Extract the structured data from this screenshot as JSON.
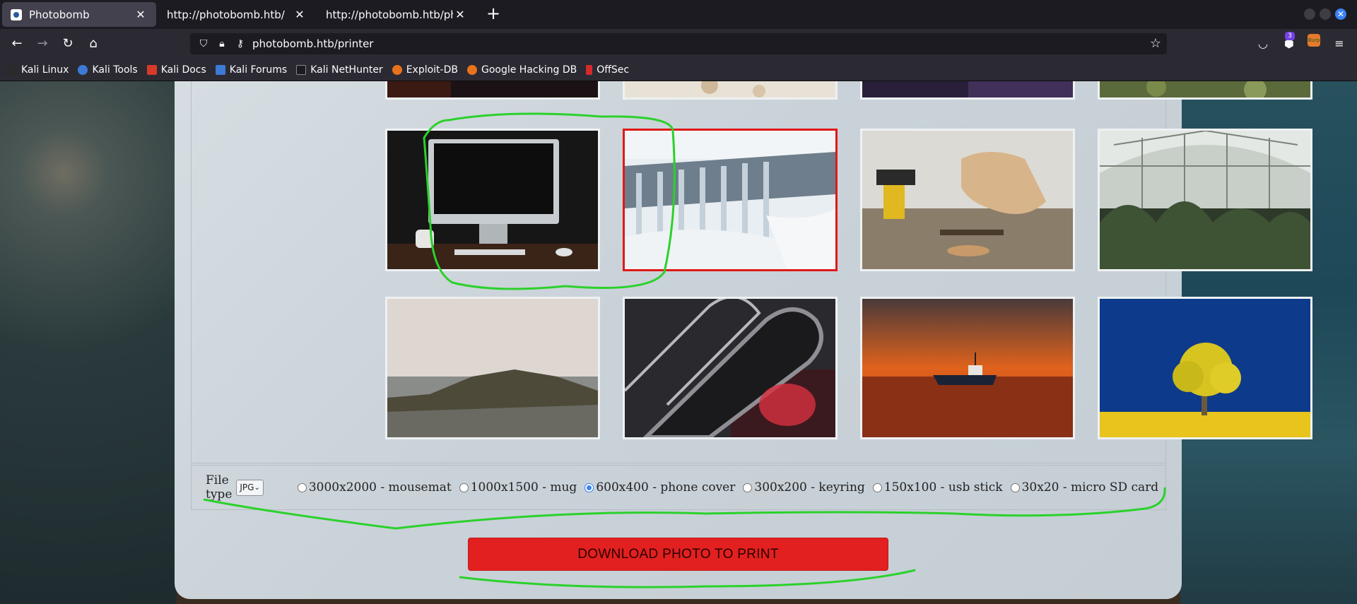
{
  "browser": {
    "tabs": [
      {
        "title": "Photobomb",
        "active": true
      },
      {
        "title": "http://photobomb.htb/",
        "active": false
      },
      {
        "title": "http://photobomb.htb/photo",
        "active": false
      }
    ],
    "url_domain": "photobomb.htb",
    "url_path": "/printer",
    "bookmarks": [
      "Kali Linux",
      "Kali Tools",
      "Kali Docs",
      "Kali Forums",
      "Kali NetHunter",
      "Exploit-DB",
      "Google Hacking DB",
      "OffSec"
    ],
    "extension_badge": "3",
    "extension_label": "Burp"
  },
  "printer": {
    "file_type_label": "File type",
    "file_type_value": "JPG",
    "size_options": [
      {
        "label": "3000x2000 - mousemat",
        "checked": false
      },
      {
        "label": "1000x1500 - mug",
        "checked": false
      },
      {
        "label": "600x400 - phone cover",
        "checked": true
      },
      {
        "label": "300x200 - keyring",
        "checked": false
      },
      {
        "label": "150x100 - usb stick",
        "checked": false
      },
      {
        "label": "30x20 - micro SD card",
        "checked": false
      }
    ],
    "download_label": "DOWNLOAD PHOTO TO PRINT"
  },
  "colors": {
    "selected_border": "#e01818",
    "download_button": "#e22020",
    "annotation": "#2bd12b",
    "accent": "#3b82f6"
  }
}
